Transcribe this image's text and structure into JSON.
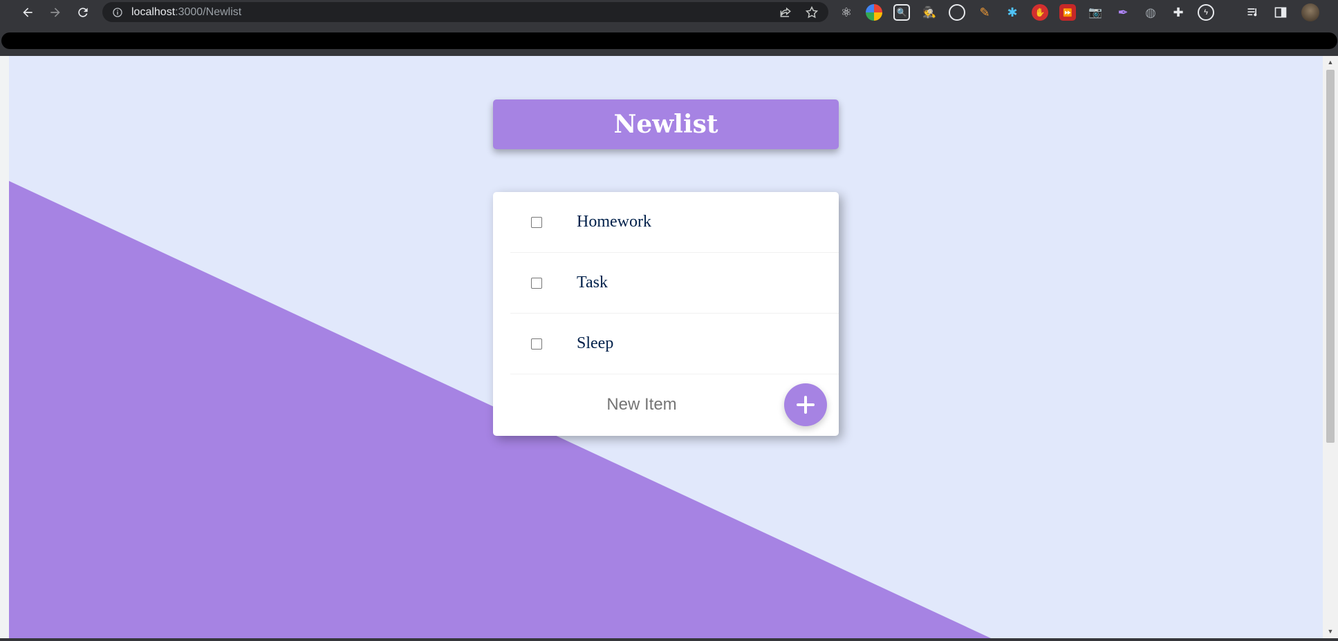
{
  "browser": {
    "url_host": "localhost",
    "url_path": ":3000/Newlist",
    "extensions": [
      "react-devtools-icon",
      "google-icon",
      "search-box-icon",
      "spy-icon",
      "target-icon",
      "pencil-icon",
      "star-icon",
      "stop-hand-icon",
      "fast-forward-icon",
      "camera-icon",
      "feather-icon",
      "globe-icon",
      "puzzle-icon",
      "refresh-bolt-icon"
    ],
    "menu_glyph": "⋮"
  },
  "page": {
    "title": "Newlist",
    "accent_color": "#a683e3",
    "background_color": "#e1e8fb",
    "items": [
      {
        "label": "Homework",
        "checked": false
      },
      {
        "label": "Task",
        "checked": false
      },
      {
        "label": "Sleep",
        "checked": false
      }
    ],
    "new_item": {
      "placeholder": "New Item",
      "value": ""
    },
    "add_button_glyph": "+"
  }
}
